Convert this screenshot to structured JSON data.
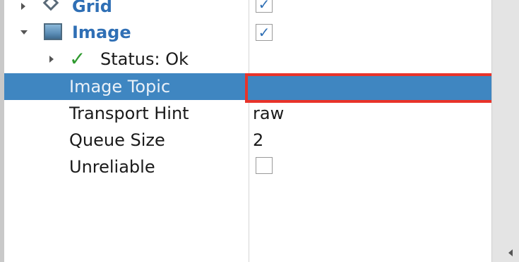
{
  "tree": {
    "grid": {
      "label": "Grid",
      "checked": true,
      "checkmark": "✓"
    },
    "image": {
      "label": "Image",
      "checked": true,
      "checkmark": "✓"
    },
    "status": {
      "label": "Status: Ok",
      "icon": "check-icon",
      "checkmark": "✓"
    },
    "properties": {
      "image_topic": {
        "label": "Image Topic",
        "value": ""
      },
      "transport_hint": {
        "label": "Transport Hint",
        "value": "raw"
      },
      "queue_size": {
        "label": "Queue Size",
        "value": "2"
      },
      "unreliable": {
        "label": "Unreliable",
        "checked": false
      }
    }
  },
  "colors": {
    "selection": "#3f86c1",
    "highlight": "#e8332a",
    "display_name": "#2f6fb5",
    "status_ok": "#2f9a2f"
  }
}
